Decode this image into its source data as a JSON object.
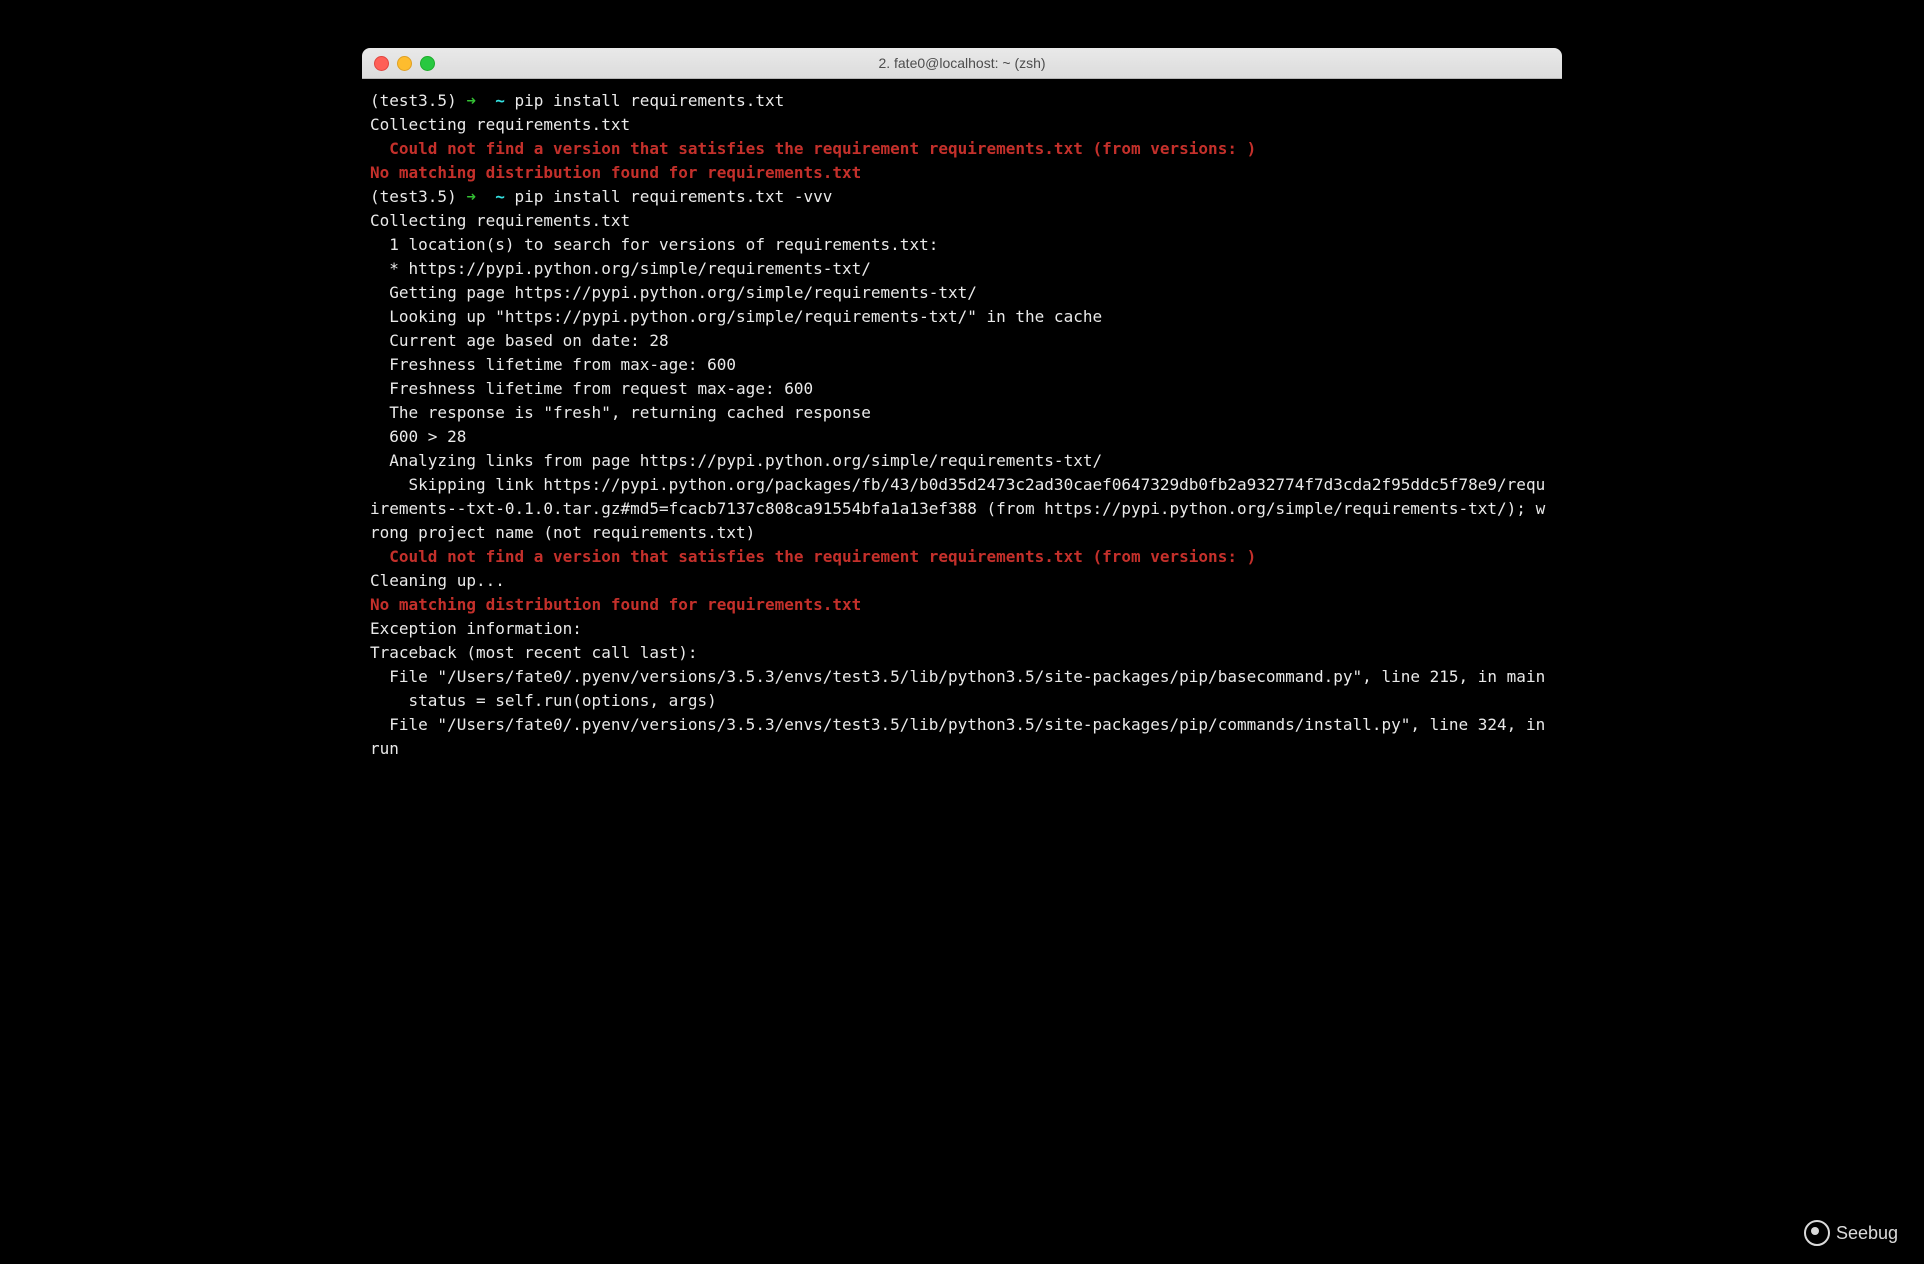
{
  "window": {
    "title": "2. fate0@localhost: ~ (zsh)"
  },
  "prompt1": {
    "env": "(test3.5)",
    "arrow": " ➜ ",
    "path": " ~ ",
    "cmd": "pip install requirements.txt"
  },
  "prompt2": {
    "env": "(test3.5)",
    "arrow": " ➜ ",
    "path": " ~ ",
    "cmd": "pip install requirements.txt -vvv"
  },
  "lines": {
    "collecting1": "Collecting requirements.txt",
    "err_nover1": "  Could not find a version that satisfies the requirement requirements.txt (from versions: )",
    "err_nomatch1": "No matching distribution found for requirements.txt",
    "collecting2": "Collecting requirements.txt",
    "loc": "  1 location(s) to search for versions of requirements.txt:",
    "star": "  * https://pypi.python.org/simple/requirements-txt/",
    "getting": "  Getting page https://pypi.python.org/simple/requirements-txt/",
    "looking": "  Looking up \"https://pypi.python.org/simple/requirements-txt/\" in the cache",
    "age": "  Current age based on date: 28",
    "fresh1": "  Freshness lifetime from max-age: 600",
    "fresh2": "  Freshness lifetime from request max-age: 600",
    "fresh3": "  The response is \"fresh\", returning cached response",
    "cmp": "  600 > 28",
    "analyze": "  Analyzing links from page https://pypi.python.org/simple/requirements-txt/",
    "skipping": "    Skipping link https://pypi.python.org/packages/fb/43/b0d35d2473c2ad30caef0647329db0fb2a932774f7d3cda2f95ddc5f78e9/requirements--txt-0.1.0.tar.gz#md5=fcacb7137c808ca91554bfa1a13ef388 (from https://pypi.python.org/simple/requirements-txt/); wrong project name (not requirements.txt)",
    "err_nover2": "  Could not find a version that satisfies the requirement requirements.txt (from versions: )",
    "cleanup": "Cleaning up...",
    "err_nomatch2": "No matching distribution found for requirements.txt",
    "exc": "Exception information:",
    "tb": "Traceback (most recent call last):",
    "file1": "  File \"/Users/fate0/.pyenv/versions/3.5.3/envs/test3.5/lib/python3.5/site-packages/pip/basecommand.py\", line 215, in main",
    "status": "    status = self.run(options, args)",
    "file2": "  File \"/Users/fate0/.pyenv/versions/3.5.3/envs/test3.5/lib/python3.5/site-packages/pip/commands/install.py\", line 324, in run"
  },
  "watermark": "Seebug"
}
